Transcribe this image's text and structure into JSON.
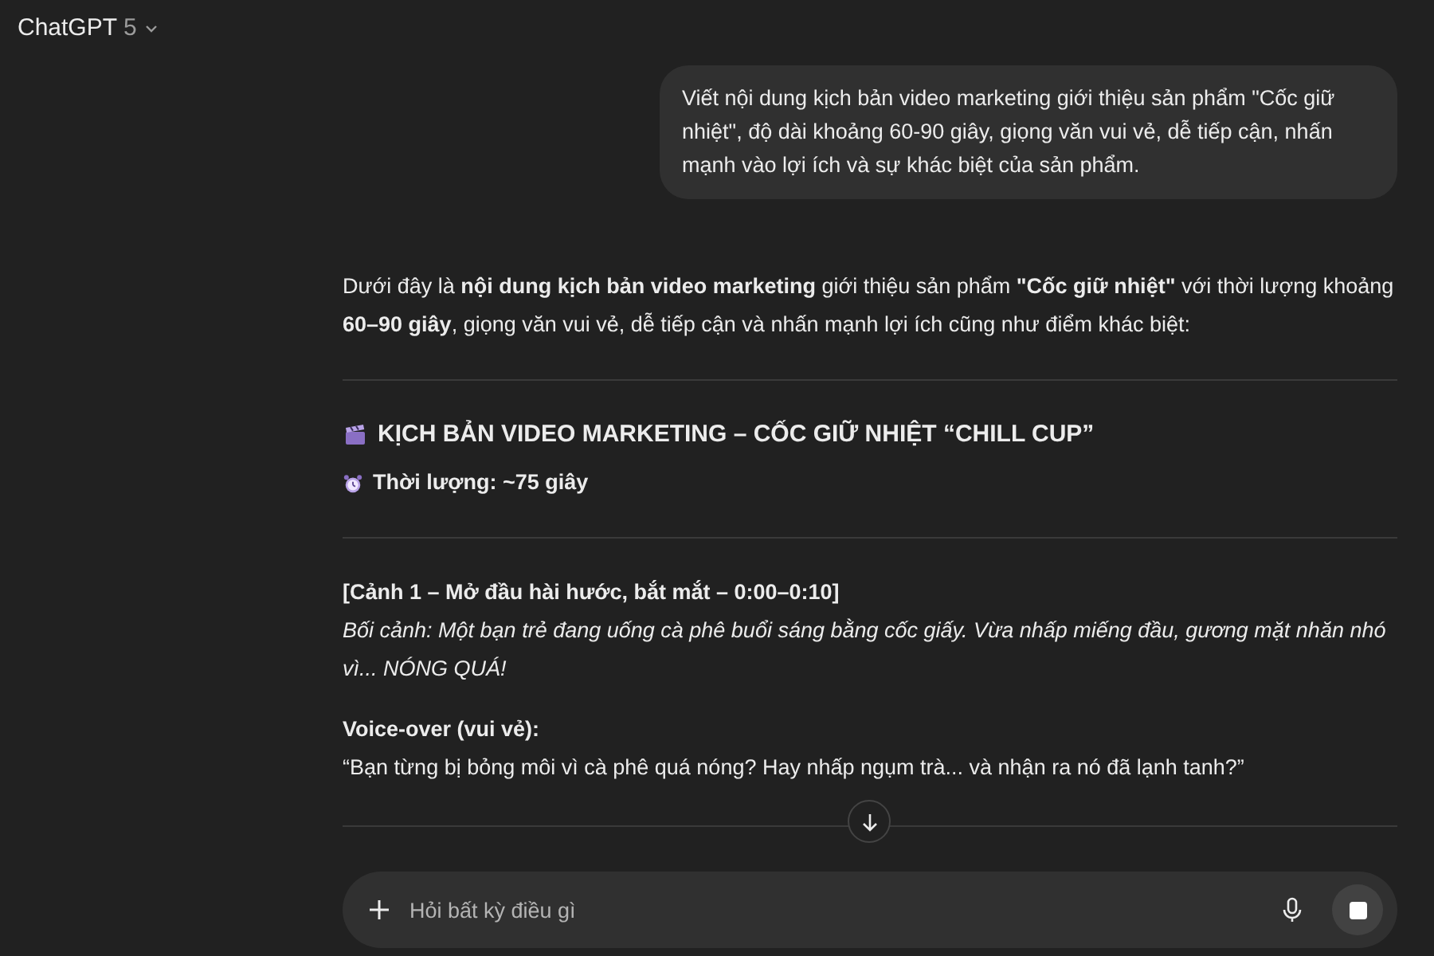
{
  "header": {
    "title": "ChatGPT",
    "version": "5"
  },
  "user_message": "Viết nội dung kịch bản video marketing giới thiệu sản phẩm \"Cốc giữ nhiệt\", độ dài khoảng 60-90 giây, giọng văn vui vẻ, dễ tiếp cận, nhấn mạnh vào lợi ích và sự khác biệt của sản phẩm.",
  "reply": {
    "intro": "Dưới đây là **nội dung kịch bản video marketing** giới thiệu sản phẩm **\"Cốc giữ nhiệt\"** với thời lượng khoảng **60–90 giây**, giọng văn vui vẻ, dễ tiếp cận và nhấn mạnh lợi ích cũng như điểm khác biệt:",
    "title": "KỊCH BẢN VIDEO MARKETING – CỐC GIỮ NHIỆT “CHILL CUP”",
    "duration": "Thời lượng: ~75 giây",
    "scene_heading": "[Cảnh 1 – Mở đầu hài hước, bắt mắt – 0:00–0:10]",
    "scene_description": "Bối cảnh: Một bạn trẻ đang uống cà phê buổi sáng bằng cốc giấy. Vừa nhấp miếng đầu, gương mặt nhăn nhó vì... NÓNG QUÁ!",
    "voiceover_label": "Voice-over (vui vẻ):",
    "voiceover_text": "“Bạn từng bị bỏng môi vì cà phê quá nóng? Hay nhấp ngụm trà... và nhận ra nó đã lạnh tanh?”"
  },
  "composer": {
    "placeholder": "Hỏi bất kỳ điều gì"
  }
}
